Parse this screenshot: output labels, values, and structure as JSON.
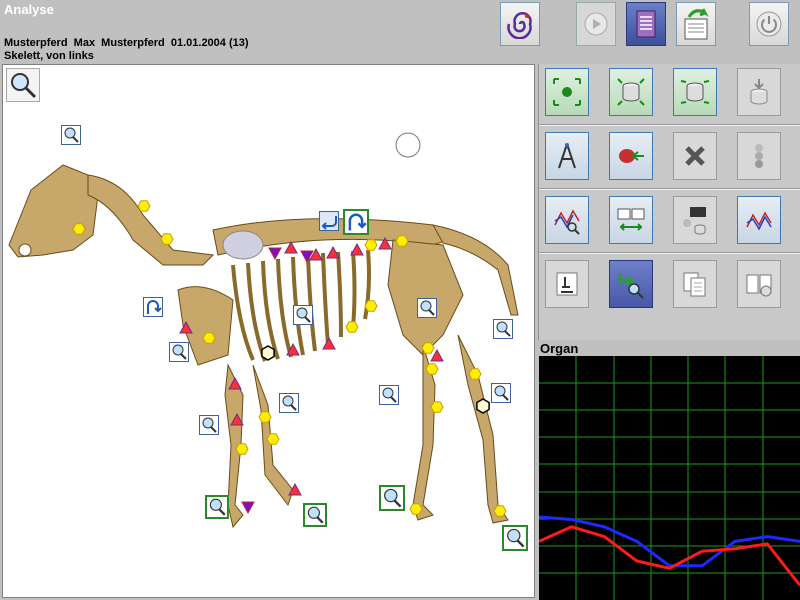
{
  "header": {
    "title": "Analyse",
    "patient_line": "Musterpferd  Max  Musterpferd  01.01.2004 (13)",
    "view_line": "Skelett, von links"
  },
  "toolbar": {
    "buttons": [
      {
        "icon": "spiral-icon",
        "state": "normal"
      },
      {
        "icon": "play-icon",
        "state": "disabled"
      },
      {
        "icon": "document-icon",
        "state": "active"
      },
      {
        "icon": "export-document-icon",
        "state": "normal"
      },
      {
        "icon": "power-icon",
        "state": "disabled"
      }
    ]
  },
  "canvas": {
    "zoom_tool": "magnifier-icon"
  },
  "side_panel": {
    "buttons": [
      "green-dot-icon",
      "database-arrows-icon",
      "database-expand-icon",
      "database-import-icon",
      "compass-icon",
      "organ-arrow-icon",
      "close-x-icon",
      "traffic-light-icon",
      "chart-search-icon",
      "compare-transfer-icon",
      "body-organ-database-icon",
      "chart-line-icon",
      "microscope-icon",
      "search-return-icon",
      "copy-documents-icon",
      "book-help-icon"
    ]
  },
  "organ": {
    "label": "Organ"
  },
  "chart_data": {
    "type": "line",
    "title": "",
    "grid": true,
    "series": [
      {
        "color": "#1a2bff",
        "values": [
          0.66,
          0.67,
          0.7,
          0.76,
          0.86,
          0.86,
          0.76,
          0.74,
          0.76
        ]
      },
      {
        "color": "#ff1a1a",
        "values": [
          0.76,
          0.7,
          0.74,
          0.84,
          0.87,
          0.8,
          0.79,
          0.77,
          0.94
        ]
      }
    ]
  },
  "colors": {
    "background": "#c0c0c0",
    "hexagon": "#ffee00",
    "triangle": "#ff3030",
    "grid": "#1a9a1a"
  }
}
